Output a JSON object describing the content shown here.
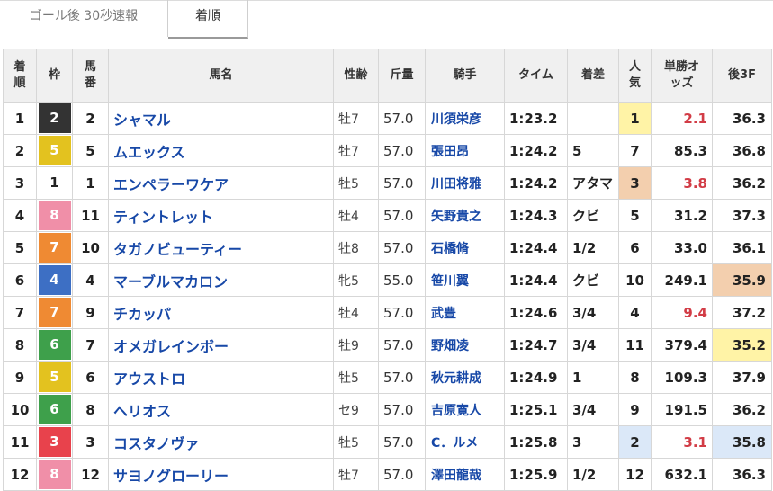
{
  "tabs": [
    {
      "label": "ゴール後 30秒速報",
      "active": false
    },
    {
      "label": "着順",
      "active": true
    }
  ],
  "table": {
    "headers": {
      "rank": "着順",
      "waku": "枠",
      "horse_no": "馬番",
      "name": "馬名",
      "sex_age": "性齢",
      "weight": "斤量",
      "jockey": "騎手",
      "time": "タイム",
      "margin": "着差",
      "popularity": "人気",
      "odds": "単勝オッズ",
      "last3f": "後3F"
    },
    "waku_colors": {
      "1": {
        "bg": "#ffffff",
        "fg": "#222222"
      },
      "2": {
        "bg": "#333333",
        "fg": "#ffffff"
      },
      "3": {
        "bg": "#e8424c",
        "fg": "#ffffff"
      },
      "4": {
        "bg": "#3d6fc4",
        "fg": "#ffffff"
      },
      "5": {
        "bg": "#e3c21f",
        "fg": "#ffffff"
      },
      "6": {
        "bg": "#3ea04b",
        "fg": "#ffffff"
      },
      "7": {
        "bg": "#ef8a33",
        "fg": "#ffffff"
      },
      "8": {
        "bg": "#f08fa8",
        "fg": "#ffffff"
      }
    },
    "highlight_colors": {
      "gold": "#fff3a6",
      "bronze": "#f3cfae",
      "silver": "#dbe8f8"
    },
    "rows": [
      {
        "rank": "1",
        "waku": "2",
        "horse_no": "2",
        "name": "シャマル",
        "sex_age": "牡7",
        "weight": "57.0",
        "jockey": "川須栄彦",
        "time": "1:23.2",
        "margin": "",
        "popularity": "1",
        "pop_hl": "gold",
        "odds": "2.1",
        "fav": true,
        "last3f": "36.3",
        "l3_hl": ""
      },
      {
        "rank": "2",
        "waku": "5",
        "horse_no": "5",
        "name": "ムエックス",
        "sex_age": "牡7",
        "weight": "57.0",
        "jockey": "張田昂",
        "time": "1:24.2",
        "margin": "5",
        "popularity": "7",
        "pop_hl": "",
        "odds": "85.3",
        "fav": false,
        "last3f": "36.8",
        "l3_hl": ""
      },
      {
        "rank": "3",
        "waku": "1",
        "horse_no": "1",
        "name": "エンペラーワケア",
        "sex_age": "牡5",
        "weight": "57.0",
        "jockey": "川田将雅",
        "time": "1:24.2",
        "margin": "アタマ",
        "popularity": "3",
        "pop_hl": "bronze",
        "odds": "3.8",
        "fav": true,
        "last3f": "36.2",
        "l3_hl": ""
      },
      {
        "rank": "4",
        "waku": "8",
        "horse_no": "11",
        "name": "ティントレット",
        "sex_age": "牡4",
        "weight": "57.0",
        "jockey": "矢野貴之",
        "time": "1:24.3",
        "margin": "クビ",
        "popularity": "5",
        "pop_hl": "",
        "odds": "31.2",
        "fav": false,
        "last3f": "37.3",
        "l3_hl": ""
      },
      {
        "rank": "5",
        "waku": "7",
        "horse_no": "10",
        "name": "タガノビューティー",
        "sex_age": "牡8",
        "weight": "57.0",
        "jockey": "石橋脩",
        "time": "1:24.4",
        "margin": "1/2",
        "popularity": "6",
        "pop_hl": "",
        "odds": "33.0",
        "fav": false,
        "last3f": "36.1",
        "l3_hl": ""
      },
      {
        "rank": "6",
        "waku": "4",
        "horse_no": "4",
        "name": "マーブルマカロン",
        "sex_age": "牝5",
        "weight": "55.0",
        "jockey": "笹川翼",
        "time": "1:24.4",
        "margin": "クビ",
        "popularity": "10",
        "pop_hl": "",
        "odds": "249.1",
        "fav": false,
        "last3f": "35.9",
        "l3_hl": "bronze"
      },
      {
        "rank": "7",
        "waku": "7",
        "horse_no": "9",
        "name": "チカッパ",
        "sex_age": "牡4",
        "weight": "57.0",
        "jockey": "武豊",
        "time": "1:24.6",
        "margin": "3/4",
        "popularity": "4",
        "pop_hl": "",
        "odds": "9.4",
        "fav": true,
        "last3f": "37.2",
        "l3_hl": ""
      },
      {
        "rank": "8",
        "waku": "6",
        "horse_no": "7",
        "name": "オメガレインボー",
        "sex_age": "牡9",
        "weight": "57.0",
        "jockey": "野畑凌",
        "time": "1:24.7",
        "margin": "3/4",
        "popularity": "11",
        "pop_hl": "",
        "odds": "379.4",
        "fav": false,
        "last3f": "35.2",
        "l3_hl": "gold"
      },
      {
        "rank": "9",
        "waku": "5",
        "horse_no": "6",
        "name": "アウストロ",
        "sex_age": "牡5",
        "weight": "57.0",
        "jockey": "秋元耕成",
        "time": "1:24.9",
        "margin": "1",
        "popularity": "8",
        "pop_hl": "",
        "odds": "109.3",
        "fav": false,
        "last3f": "37.9",
        "l3_hl": ""
      },
      {
        "rank": "10",
        "waku": "6",
        "horse_no": "8",
        "name": "ヘリオス",
        "sex_age": "セ9",
        "weight": "57.0",
        "jockey": "吉原寛人",
        "time": "1:25.1",
        "margin": "3/4",
        "popularity": "9",
        "pop_hl": "",
        "odds": "191.5",
        "fav": false,
        "last3f": "36.2",
        "l3_hl": ""
      },
      {
        "rank": "11",
        "waku": "3",
        "horse_no": "3",
        "name": "コスタノヴァ",
        "sex_age": "牡5",
        "weight": "57.0",
        "jockey": "C．ルメ",
        "time": "1:25.8",
        "margin": "3",
        "popularity": "2",
        "pop_hl": "silver",
        "odds": "3.1",
        "fav": true,
        "last3f": "35.8",
        "l3_hl": "silver"
      },
      {
        "rank": "12",
        "waku": "8",
        "horse_no": "12",
        "name": "サヨノグローリー",
        "sex_age": "牡7",
        "weight": "57.0",
        "jockey": "澤田龍哉",
        "time": "1:25.9",
        "margin": "1/2",
        "popularity": "12",
        "pop_hl": "",
        "odds": "632.1",
        "fav": false,
        "last3f": "36.3",
        "l3_hl": ""
      }
    ]
  }
}
